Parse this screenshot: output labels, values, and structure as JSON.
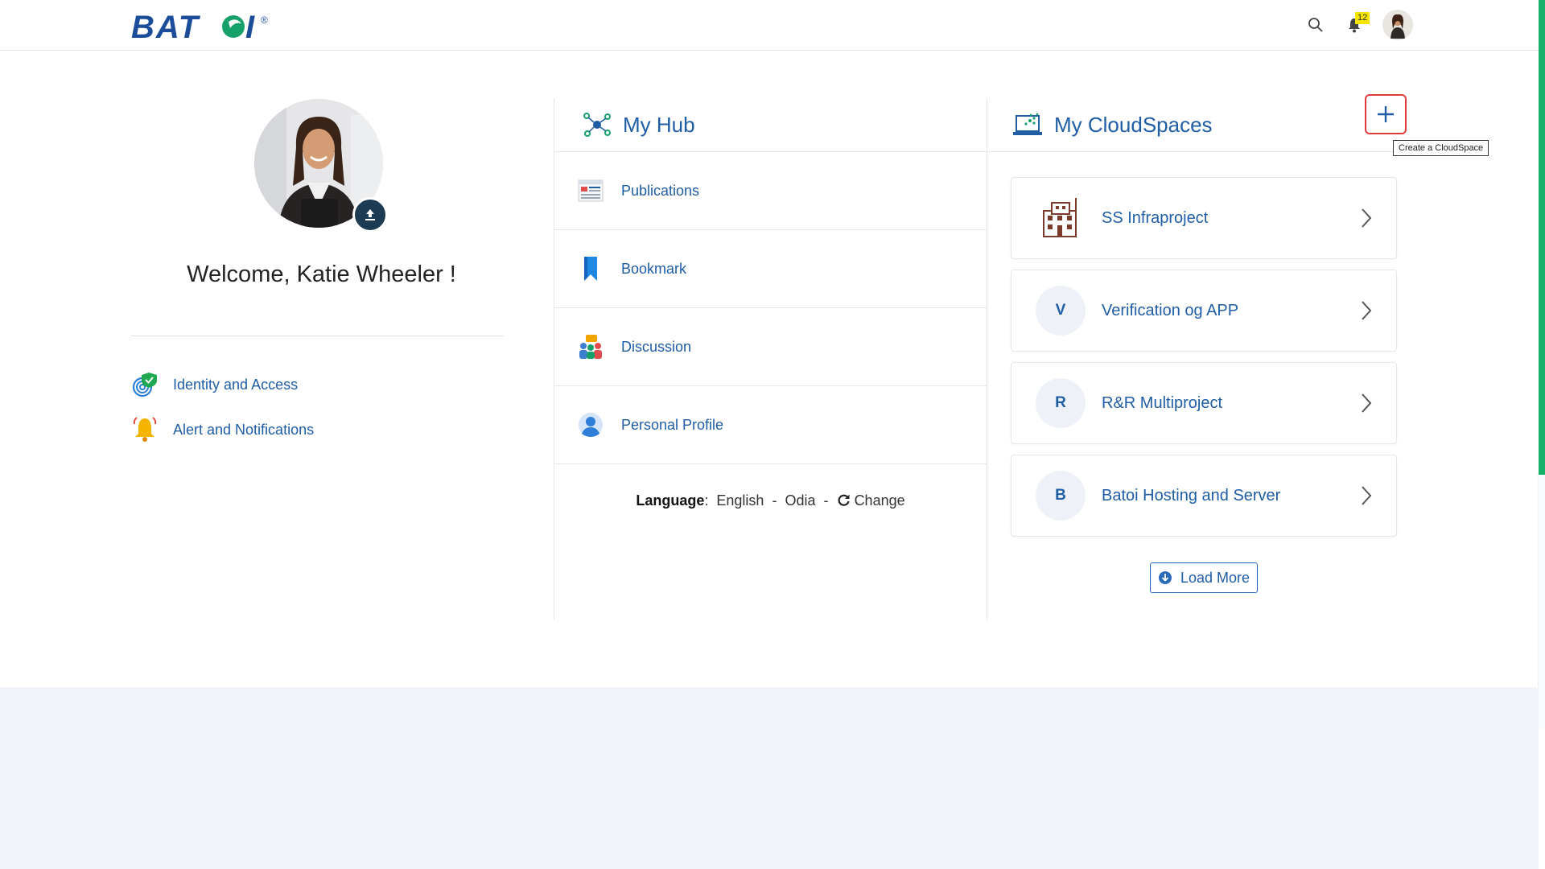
{
  "header": {
    "logo_text": "BATOI",
    "logo_registered": "®",
    "notification_count": "12"
  },
  "profile": {
    "welcome": "Welcome, Katie Wheeler !",
    "links": [
      {
        "label": "Identity and Access",
        "icon": "fingerprint-shield-icon"
      },
      {
        "label": "Alert and Notifications",
        "icon": "bell-alert-icon"
      }
    ]
  },
  "hub": {
    "title": "My Hub",
    "items": [
      {
        "label": "Publications",
        "icon": "publications-icon"
      },
      {
        "label": "Bookmark",
        "icon": "bookmark-icon"
      },
      {
        "label": "Discussion",
        "icon": "discussion-icon"
      },
      {
        "label": "Personal Profile",
        "icon": "person-icon"
      }
    ],
    "language_label": "Language",
    "languages": [
      "English",
      "Odia"
    ],
    "separator": "-",
    "change_label": "Change"
  },
  "cloud": {
    "title": "My CloudSpaces",
    "tooltip": "Create a CloudSpace",
    "spaces": [
      {
        "name": "SS Infraproject",
        "initial": ""
      },
      {
        "name": "Verification og APP",
        "initial": "V"
      },
      {
        "name": "R&R Multiproject",
        "initial": "R"
      },
      {
        "name": "Batoi Hosting and Server",
        "initial": "B"
      }
    ],
    "load_more": "Load More"
  },
  "colors": {
    "primary_text": "#1f5da5",
    "accent_green": "#17b26a",
    "add_border": "#e23a3a",
    "footer_bg": "#f1f4f8"
  }
}
